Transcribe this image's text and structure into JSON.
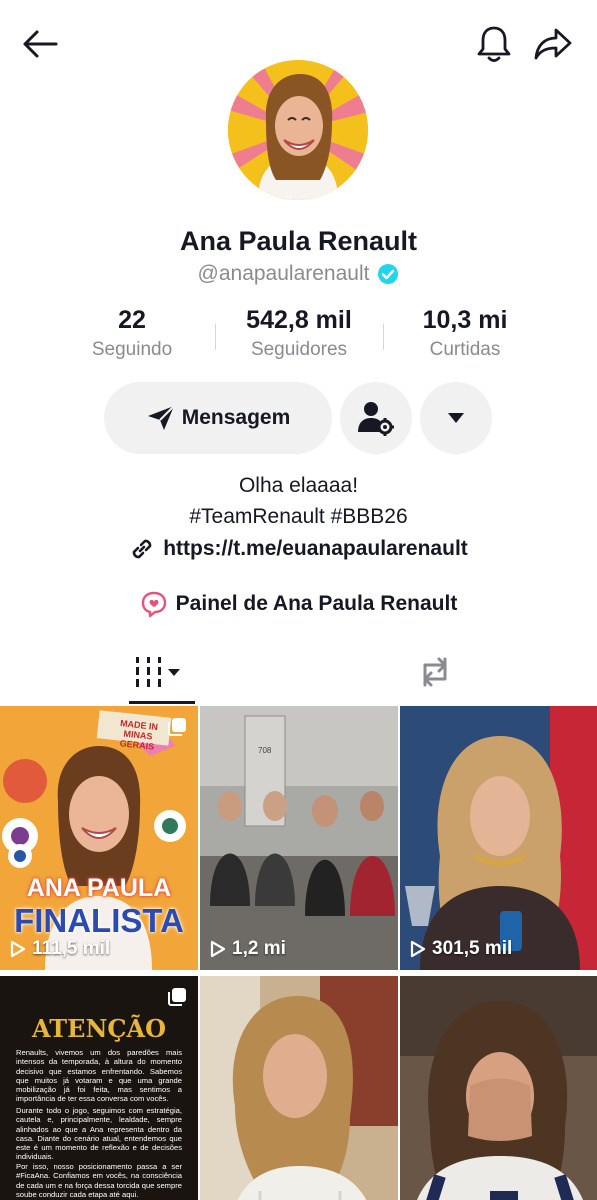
{
  "profile": {
    "name": "Ana Paula Renault",
    "handle": "@anapaularenault",
    "verified": true
  },
  "stats": [
    {
      "value": "22",
      "label": "Seguindo"
    },
    {
      "value": "542,8 mil",
      "label": "Seguidores"
    },
    {
      "value": "10,3 mi",
      "label": "Curtidas"
    }
  ],
  "actions": {
    "message_label": "Mensagem"
  },
  "bio": {
    "line1": "Olha elaaaa!",
    "line2": "#TeamRenault #BBB26",
    "link": "https://t.me/euanapaularenault",
    "panel": "Painel de Ana Paula Renault"
  },
  "colors": {
    "accent": "#20d5ec",
    "text": "#161823",
    "muted": "#8a8b91",
    "button_bg": "#f1f1f2",
    "panel_icon": "#e8527a"
  },
  "videos": [
    {
      "views": "111,5 mil",
      "overlay_top": "MADE IN MINAS GERAIS",
      "overlay_line1": "ANA PAULA",
      "overlay_line2": "FINALISTA",
      "multi": false
    },
    {
      "views": "1,2 mi",
      "room_number": "708"
    },
    {
      "views": "301,5 mil"
    },
    {
      "title": "ATENÇÃO",
      "multi": true,
      "p1": "Renaults, vivemos um dos paredões mais intensos da temporada, à altura do momento decisivo que estamos enfrentando. Sabemos que muitos já votaram e que uma grande mobilização já foi feita, mas sentimos a importância de ter essa conversa com vocês.",
      "p2": "Durante todo o jogo, seguimos com estratégia, cautela e, principalmente, lealdade, sempre alinhados ao que a Ana representa dentro da casa. Diante do cenário atual, entendemos que este é um momento de reflexão e de decisões individuais.",
      "p3": "Por isso, nosso posicionamento passa a ser #FicaAna. Confiamos em vocês, na consciência de cada um e na força dessa torcida que sempre soube conduzir cada etapa até aqui."
    },
    {},
    {}
  ]
}
